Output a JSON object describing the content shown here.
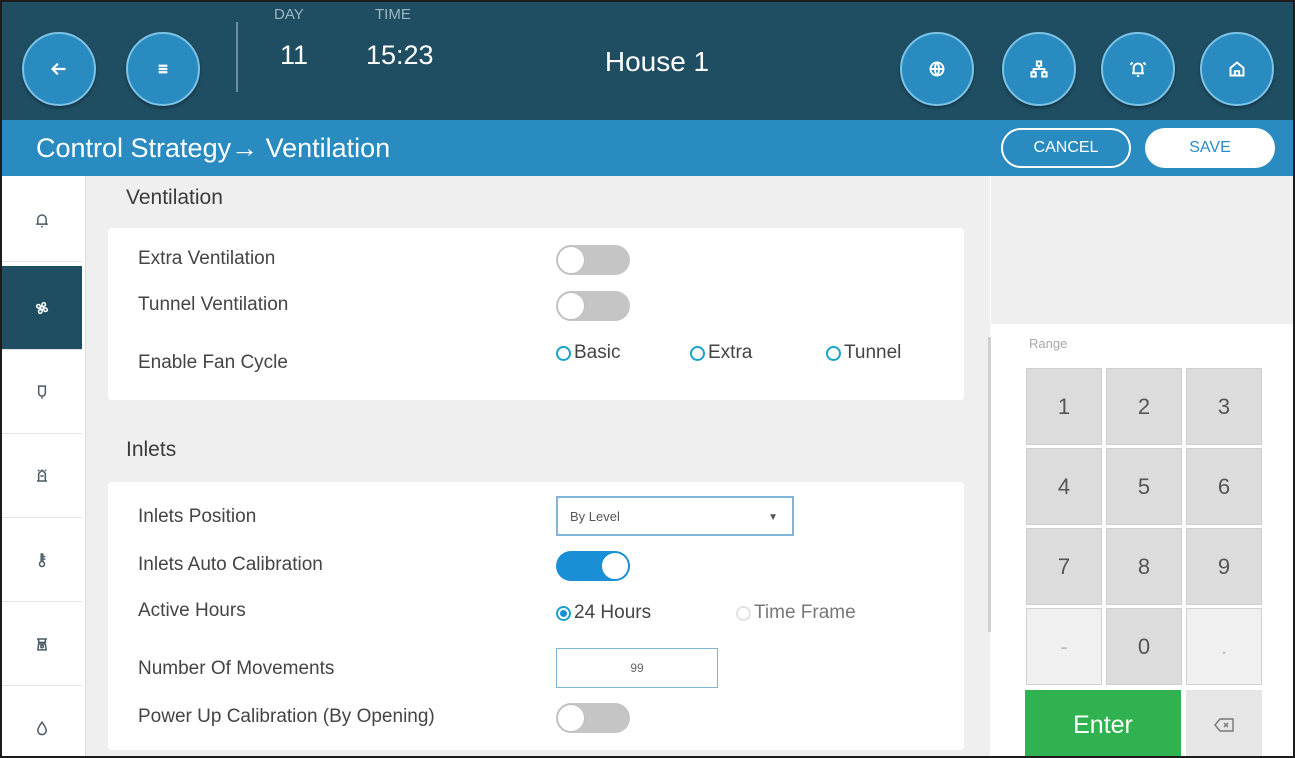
{
  "header": {
    "day_label": "DAY",
    "day_value": "11",
    "time_label": "TIME",
    "time_value": "15:23",
    "house_title": "House 1",
    "left_buttons": [
      "back-arrow-icon",
      "menu-icon"
    ],
    "right_buttons": [
      "globe-icon",
      "network-icon",
      "alarm-bell-icon",
      "home-icon"
    ]
  },
  "titlebar": {
    "breadcrumb": "Control Strategy→ Ventilation",
    "cancel_label": "CANCEL",
    "save_label": "SAVE"
  },
  "sidebar": {
    "items": [
      {
        "icon": "alarm-bell-icon",
        "active": false
      },
      {
        "icon": "fan-icon",
        "active": true
      },
      {
        "icon": "sensor-probe-icon",
        "active": false
      },
      {
        "icon": "heater-icon",
        "active": false
      },
      {
        "icon": "thermometer-icon",
        "active": false
      },
      {
        "icon": "scale-icon",
        "active": false
      },
      {
        "icon": "water-drop-icon",
        "active": false
      }
    ]
  },
  "ventilation": {
    "section_title": "Ventilation",
    "extra_ventilation_label": "Extra Ventilation",
    "extra_ventilation_on": false,
    "tunnel_ventilation_label": "Tunnel Ventilation",
    "tunnel_ventilation_on": false,
    "fan_cycle_label": "Enable Fan Cycle",
    "fan_cycle_options": [
      "Basic",
      "Extra",
      "Tunnel"
    ]
  },
  "inlets": {
    "section_title": "Inlets",
    "position_label": "Inlets Position",
    "position_value": "By Level",
    "auto_calibration_label": "Inlets Auto Calibration",
    "auto_calibration_on": true,
    "active_hours_label": "Active Hours",
    "active_hours_options": [
      "24 Hours",
      "Time Frame"
    ],
    "active_hours_selected": "24 Hours",
    "movements_label": "Number Of Movements",
    "movements_value": "99",
    "power_up_label": "Power Up Calibration (By Opening)",
    "power_up_on": false
  },
  "keypad": {
    "range_label": "Range",
    "keys": [
      "1",
      "2",
      "3",
      "4",
      "5",
      "6",
      "7",
      "8",
      "9",
      "-",
      "0",
      "."
    ],
    "enter_label": "Enter",
    "backspace_icon": "backspace-icon"
  },
  "colors": {
    "header_bg": "#1f4e63",
    "accent": "#2a8bc0",
    "toggle_on": "#1a8fd6",
    "enter_green": "#2fb24f"
  }
}
